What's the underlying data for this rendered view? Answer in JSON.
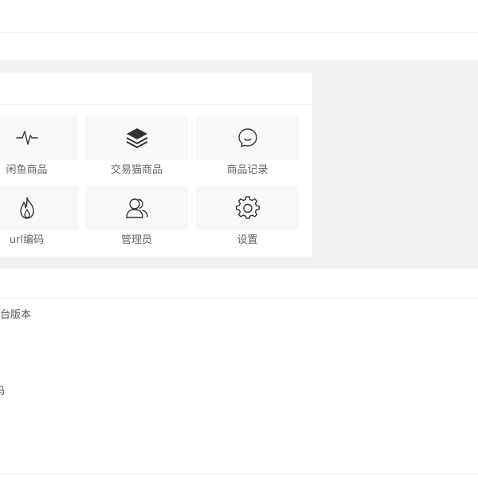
{
  "shortcuts": [
    {
      "label": "闲鱼商品",
      "icon": "pulse-icon"
    },
    {
      "label": "交易猫商品",
      "icon": "layers-icon"
    },
    {
      "label": "商品记录",
      "icon": "smile-icon"
    },
    {
      "label": "url编码",
      "icon": "fire-icon"
    },
    {
      "label": "管理员",
      "icon": "users-icon"
    },
    {
      "label": "设置",
      "icon": "gear-icon"
    }
  ],
  "info": {
    "version_label": "台版本",
    "cut_char": "码"
  },
  "colors": {
    "background": "#f2f2f2",
    "tile": "#f8f8f8",
    "icon": "#333333",
    "text": "#666666"
  }
}
